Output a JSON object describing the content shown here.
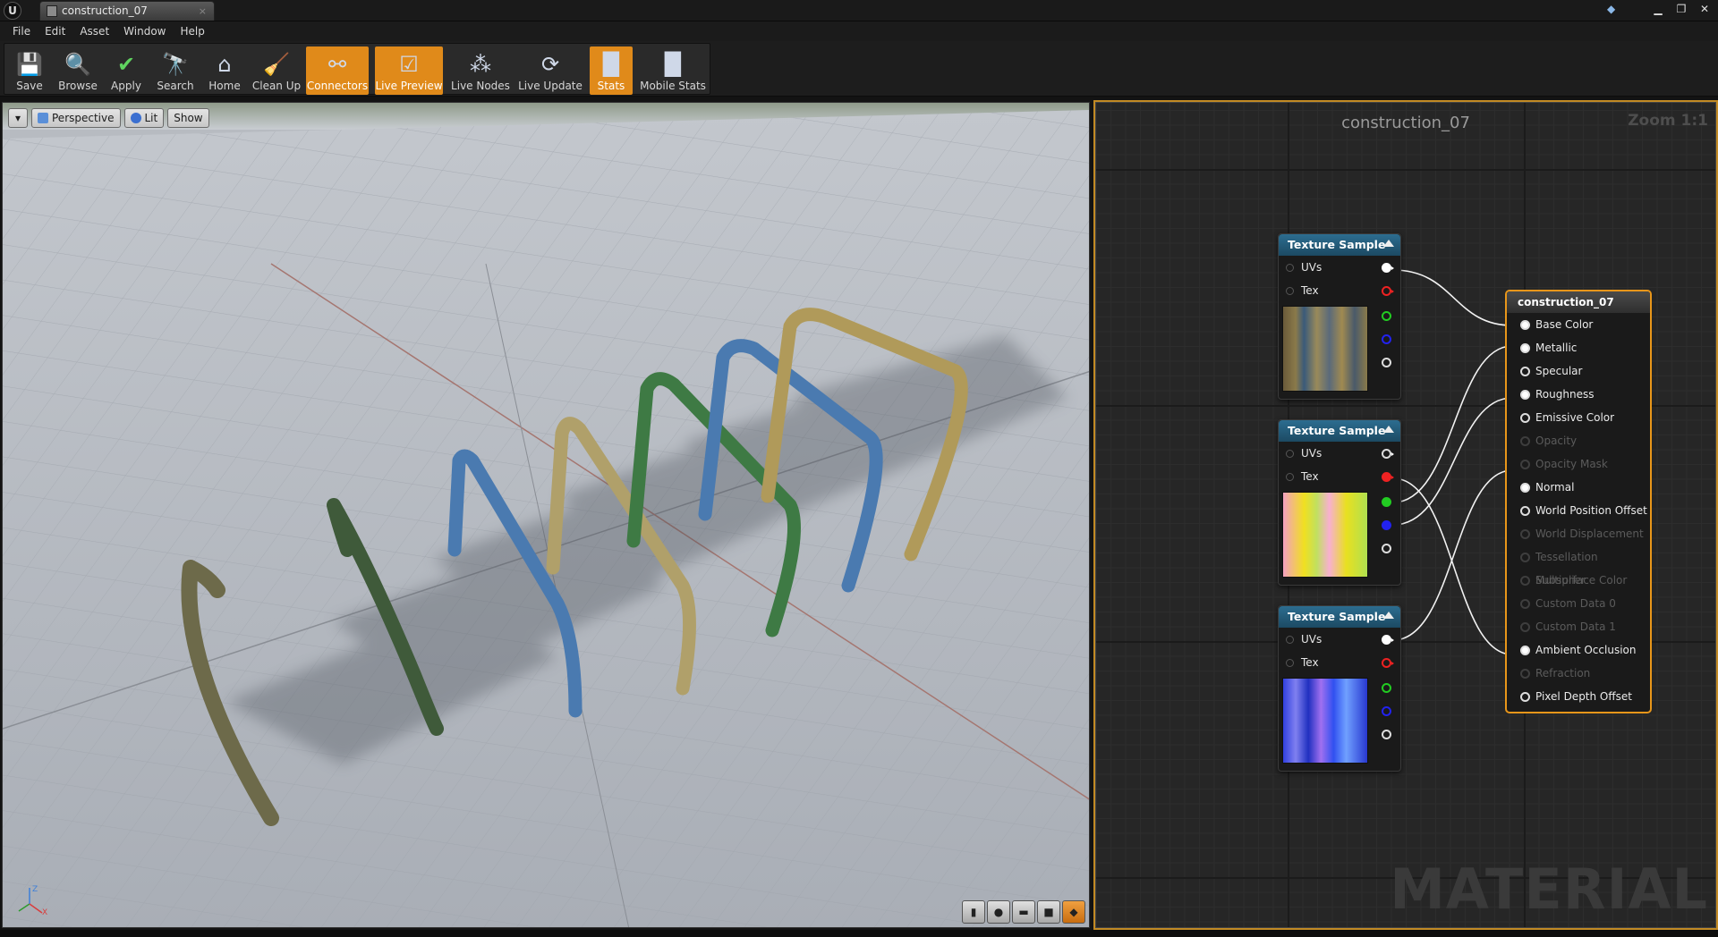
{
  "window": {
    "tab_title": "construction_07"
  },
  "menu": [
    "File",
    "Edit",
    "Asset",
    "Window",
    "Help"
  ],
  "toolbar": [
    {
      "label": "Save",
      "icon": "save-icon",
      "active": false
    },
    {
      "label": "Browse",
      "icon": "browse-icon",
      "active": false
    },
    {
      "label": "Apply",
      "icon": "apply-icon",
      "active": false
    },
    {
      "label": "Search",
      "icon": "search-icon",
      "active": false
    },
    {
      "label": "Home",
      "icon": "home-icon",
      "active": false
    },
    {
      "label": "Clean Up",
      "icon": "clean-up-icon",
      "active": false
    },
    {
      "label": "Connectors",
      "icon": "connectors-icon",
      "active": true
    },
    {
      "label": "Live Preview",
      "icon": "live-preview-icon",
      "active": true
    },
    {
      "label": "Live Nodes",
      "icon": "live-nodes-icon",
      "active": false
    },
    {
      "label": "Live Update",
      "icon": "live-update-icon",
      "active": false
    },
    {
      "label": "Stats",
      "icon": "stats-icon",
      "active": true
    },
    {
      "label": "Mobile Stats",
      "icon": "mobile-stats-icon",
      "active": false
    }
  ],
  "viewport": {
    "perspective_label": "Perspective",
    "lit_label": "Lit",
    "show_label": "Show",
    "axis_z": "Z",
    "axis_x": "X"
  },
  "graph": {
    "title": "construction_07",
    "zoom": "Zoom 1:1",
    "watermark": "MATERIAL",
    "texture_nodes": [
      {
        "title": "Texture Sample",
        "inputs": [
          "UVs",
          "Tex"
        ],
        "thumb": "wood-panel"
      },
      {
        "title": "Texture Sample",
        "inputs": [
          "UVs",
          "Tex"
        ],
        "thumb": "orm-map"
      },
      {
        "title": "Texture Sample",
        "inputs": [
          "UVs",
          "Tex"
        ],
        "thumb": "normal-map"
      }
    ],
    "material_node": {
      "title": "construction_07",
      "pins": [
        {
          "label": "Base Color",
          "enabled": true,
          "connected": true
        },
        {
          "label": "Metallic",
          "enabled": true,
          "connected": true
        },
        {
          "label": "Specular",
          "enabled": true,
          "connected": false
        },
        {
          "label": "Roughness",
          "enabled": true,
          "connected": true
        },
        {
          "label": "Emissive Color",
          "enabled": true,
          "connected": false
        },
        {
          "label": "Opacity",
          "enabled": false,
          "connected": false
        },
        {
          "label": "Opacity Mask",
          "enabled": false,
          "connected": false
        },
        {
          "label": "Normal",
          "enabled": true,
          "connected": true
        },
        {
          "label": "World Position Offset",
          "enabled": true,
          "connected": false
        },
        {
          "label": "World Displacement",
          "enabled": false,
          "connected": false
        },
        {
          "label": "Tessellation Multiplier",
          "enabled": false,
          "connected": false
        },
        {
          "label": "Subsurface Color",
          "enabled": false,
          "connected": false
        },
        {
          "label": "Custom Data 0",
          "enabled": false,
          "connected": false
        },
        {
          "label": "Custom Data 1",
          "enabled": false,
          "connected": false
        },
        {
          "label": "Ambient Occlusion",
          "enabled": true,
          "connected": true
        },
        {
          "label": "Refraction",
          "enabled": false,
          "connected": false
        },
        {
          "label": "Pixel Depth Offset",
          "enabled": true,
          "connected": false
        }
      ]
    }
  },
  "colors": {
    "accent": "#e08a1a",
    "node_header": "#2c6d90",
    "graph_bg": "#262626"
  }
}
